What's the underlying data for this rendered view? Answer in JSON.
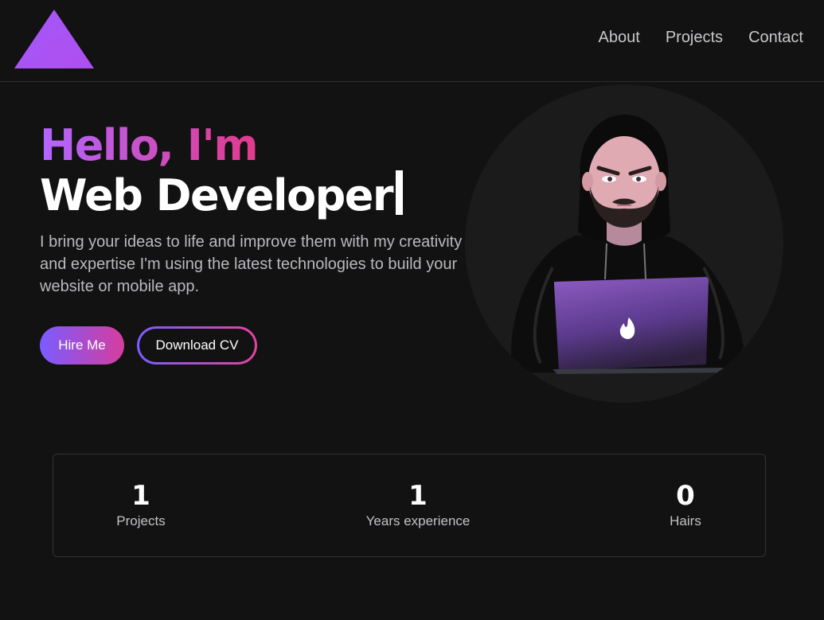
{
  "header": {
    "logo_icon": "triangle-logo-icon",
    "nav": [
      {
        "label": "About"
      },
      {
        "label": "Projects"
      },
      {
        "label": "Contact"
      }
    ]
  },
  "hero": {
    "greeting": "Hello, I'm",
    "role": "Web Developer",
    "description": "I bring your ideas to life and improve them with my creativity and expertise I'm using the latest technologies to build your website or mobile app.",
    "hire_label": "Hire Me",
    "cv_label": "Download CV",
    "avatar_icon": "developer-avatar-illustration"
  },
  "stats": [
    {
      "value": "1",
      "label": "Projects"
    },
    {
      "value": "1",
      "label": "Years experience"
    },
    {
      "value": "0",
      "label": "Hairs"
    }
  ],
  "colors": {
    "background": "#121212",
    "accent_start": "#b266ff",
    "accent_end": "#e23a8c",
    "logo": "#a855f7"
  }
}
